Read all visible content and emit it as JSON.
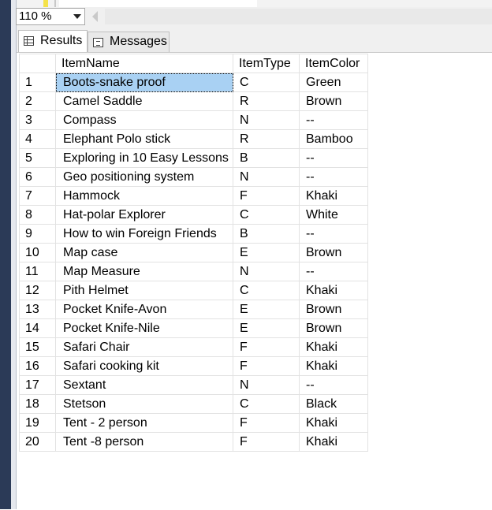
{
  "zoom": {
    "value": "110 %"
  },
  "tabs": {
    "results": "Results",
    "messages": "Messages"
  },
  "grid": {
    "columns": [
      "ItemName",
      "ItemType",
      "ItemColor"
    ],
    "selected_row": 1,
    "rows": [
      {
        "n": "1",
        "name": "Boots-snake proof",
        "type": "C",
        "color": "Green"
      },
      {
        "n": "2",
        "name": "Camel Saddle",
        "type": "R",
        "color": "Brown"
      },
      {
        "n": "3",
        "name": "Compass",
        "type": "N",
        "color": "--"
      },
      {
        "n": "4",
        "name": "Elephant Polo stick",
        "type": "R",
        "color": "Bamboo"
      },
      {
        "n": "5",
        "name": "Exploring in 10 Easy Lessons",
        "type": "B",
        "color": "--"
      },
      {
        "n": "6",
        "name": "Geo positioning system",
        "type": "N",
        "color": "--"
      },
      {
        "n": "7",
        "name": "Hammock",
        "type": "F",
        "color": "Khaki"
      },
      {
        "n": "8",
        "name": "Hat-polar Explorer",
        "type": "C",
        "color": "White"
      },
      {
        "n": "9",
        "name": "How to win Foreign Friends",
        "type": "B",
        "color": "--"
      },
      {
        "n": "10",
        "name": "Map case",
        "type": "E",
        "color": "Brown"
      },
      {
        "n": "11",
        "name": "Map Measure",
        "type": "N",
        "color": "--"
      },
      {
        "n": "12",
        "name": "Pith Helmet",
        "type": "C",
        "color": "Khaki"
      },
      {
        "n": "13",
        "name": "Pocket Knife-Avon",
        "type": "E",
        "color": "Brown"
      },
      {
        "n": "14",
        "name": "Pocket Knife-Nile",
        "type": "E",
        "color": "Brown"
      },
      {
        "n": "15",
        "name": "Safari Chair",
        "type": "F",
        "color": "Khaki"
      },
      {
        "n": "16",
        "name": "Safari cooking kit",
        "type": "F",
        "color": "Khaki"
      },
      {
        "n": "17",
        "name": "Sextant",
        "type": "N",
        "color": "--"
      },
      {
        "n": "18",
        "name": "Stetson",
        "type": "C",
        "color": "Black"
      },
      {
        "n": "19",
        "name": "Tent - 2 person",
        "type": "F",
        "color": "Khaki"
      },
      {
        "n": "20",
        "name": "Tent -8 person",
        "type": "F",
        "color": "Khaki"
      }
    ]
  }
}
